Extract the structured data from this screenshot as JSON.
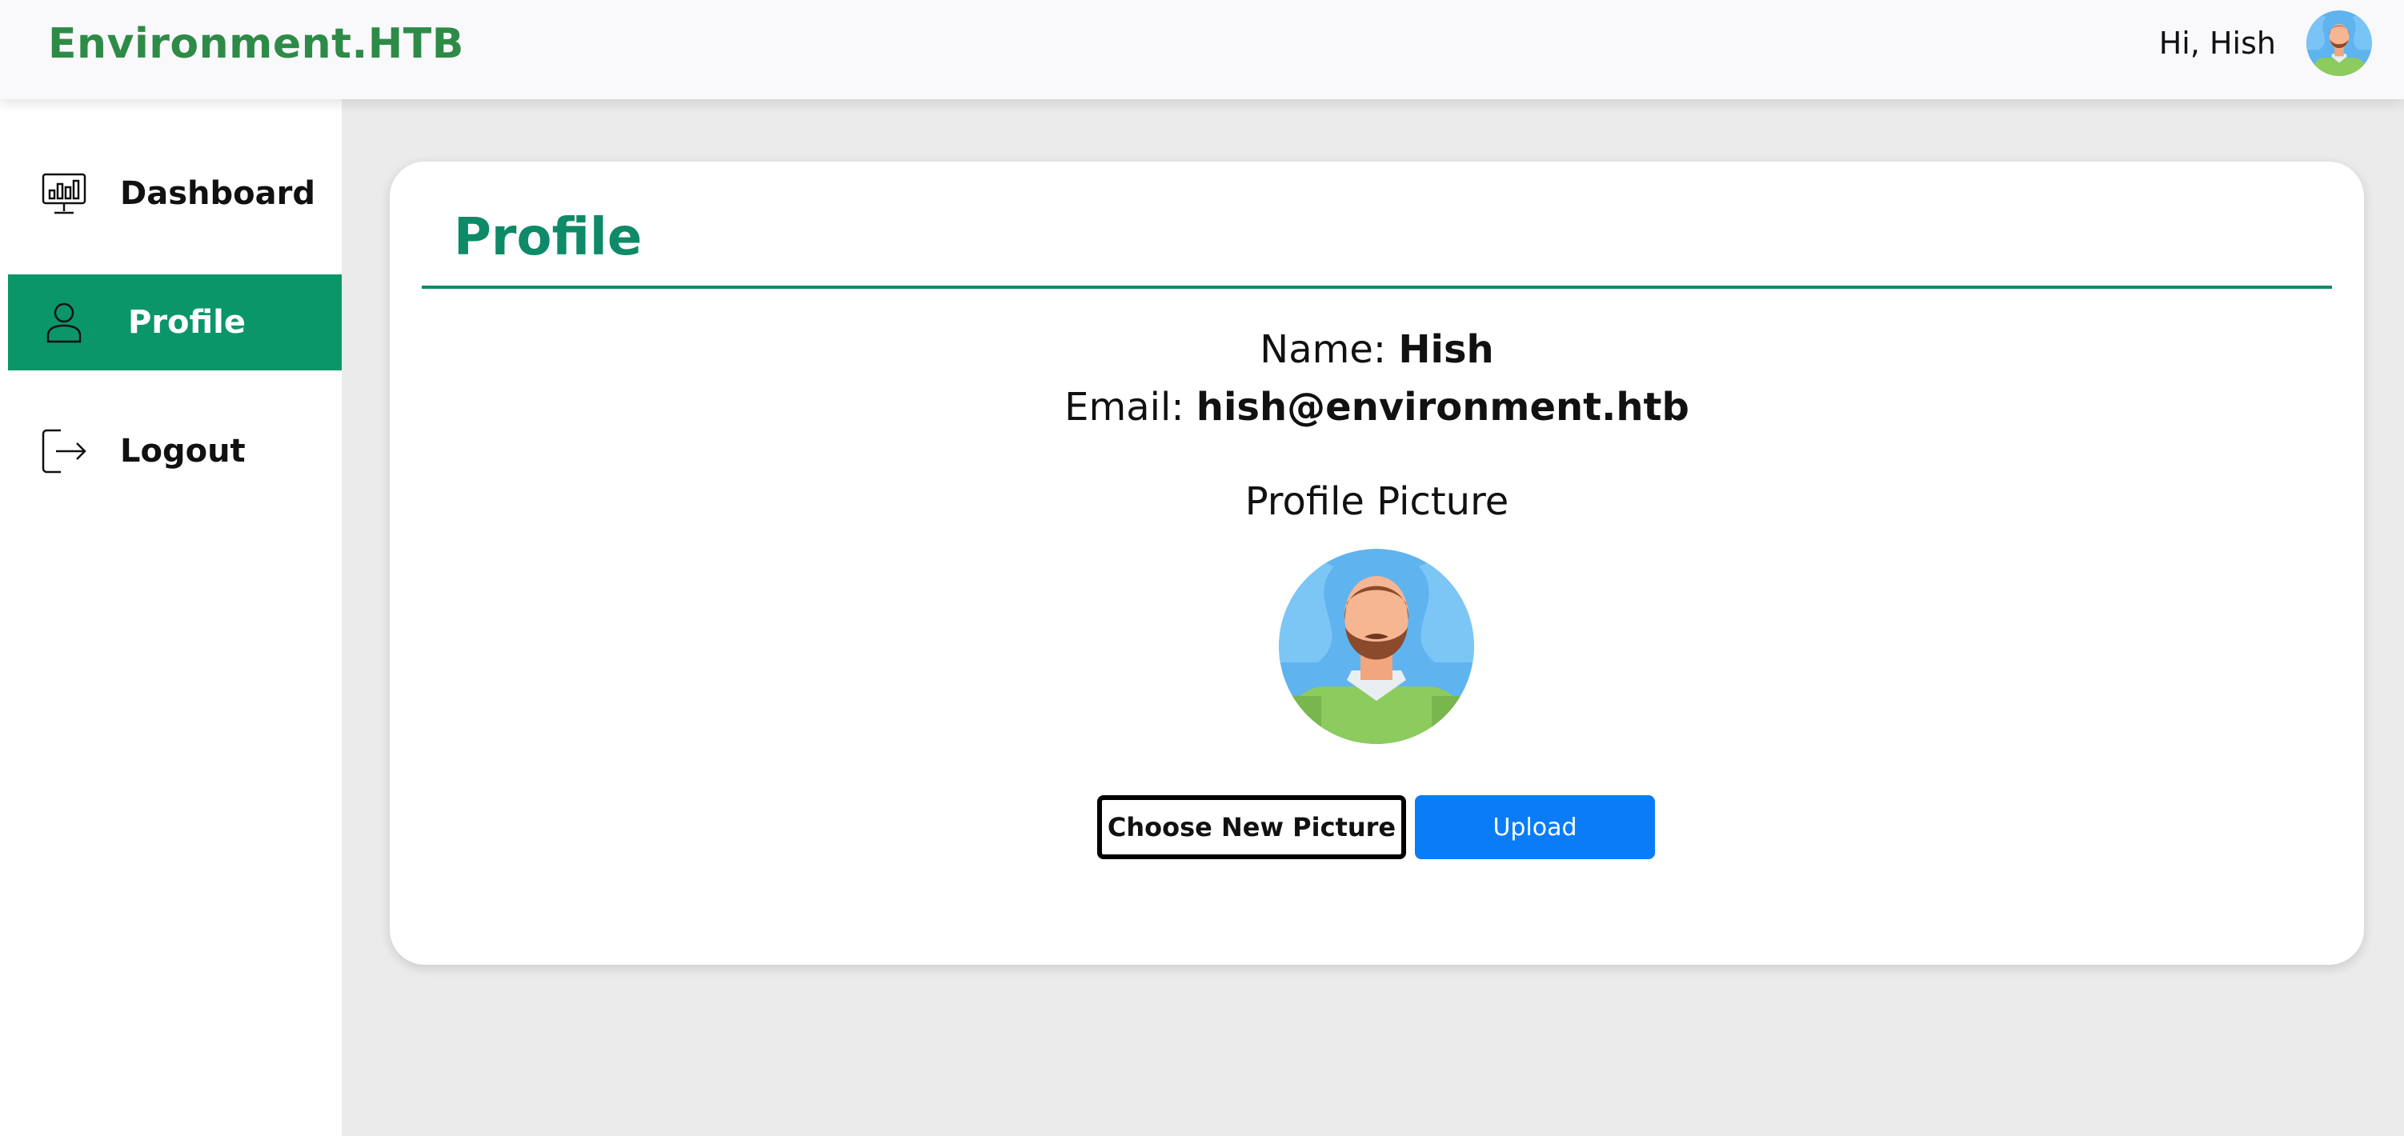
{
  "header": {
    "brand": "Environment.HTB",
    "greeting": "Hi, Hish",
    "avatar_icon": "user-avatar-icon"
  },
  "sidebar": {
    "items": [
      {
        "label": "Dashboard",
        "icon": "monitor-chart-icon",
        "active": false
      },
      {
        "label": "Profile",
        "icon": "user-icon",
        "active": true
      },
      {
        "label": "Logout",
        "icon": "logout-icon",
        "active": false
      }
    ]
  },
  "profile": {
    "title": "Profile",
    "name_label": "Name:",
    "name_value": "Hish",
    "email_label": "Email:",
    "email_value": "hish@environment.htb",
    "picture_title": "Profile Picture",
    "choose_button": "Choose New Picture",
    "upload_button": "Upload"
  },
  "colors": {
    "brand": "#2e8b47",
    "accent": "#0a9669",
    "upload": "#0a7cf7"
  }
}
